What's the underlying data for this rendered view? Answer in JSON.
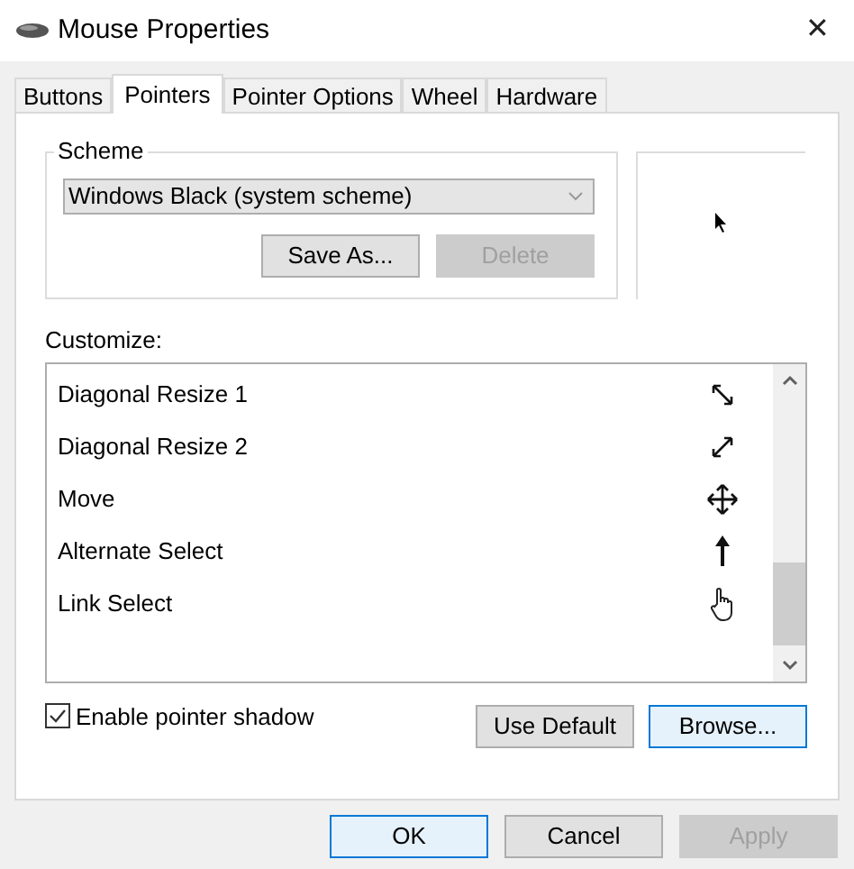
{
  "window": {
    "title": "Mouse Properties",
    "close": "✕"
  },
  "tabs": [
    {
      "label": "Buttons",
      "selected": false
    },
    {
      "label": "Pointers",
      "selected": true
    },
    {
      "label": "Pointer Options",
      "selected": false
    },
    {
      "label": "Wheel",
      "selected": false
    },
    {
      "label": "Hardware",
      "selected": false
    }
  ],
  "scheme": {
    "label": "Scheme",
    "value": "Windows Black (system scheme)",
    "buttons": [
      {
        "label": "Save As...",
        "disabled": false
      },
      {
        "label": "Delete",
        "disabled": true
      }
    ]
  },
  "customize": {
    "label": "Customize:",
    "rows": [
      {
        "name": "Diagonal Resize 1",
        "kind": "diag1",
        "selected": false
      },
      {
        "name": "Diagonal Resize 2",
        "kind": "diag2",
        "selected": false
      },
      {
        "name": "Move",
        "kind": "move",
        "selected": false
      },
      {
        "name": "Alternate Select",
        "kind": "up",
        "selected": false
      },
      {
        "name": "Link Select",
        "kind": "hand",
        "selected": false
      }
    ]
  },
  "shadow": {
    "label": "Enable pointer shadow",
    "checked": true
  },
  "pointer_buttons": [
    {
      "label": "Use Default",
      "focused": false
    },
    {
      "label": "Browse...",
      "focused": true
    }
  ],
  "footer_buttons": [
    {
      "label": "OK",
      "disabled": false,
      "focused": true
    },
    {
      "label": "Cancel",
      "disabled": false,
      "focused": false
    },
    {
      "label": "Apply",
      "disabled": true,
      "focused": false
    }
  ]
}
